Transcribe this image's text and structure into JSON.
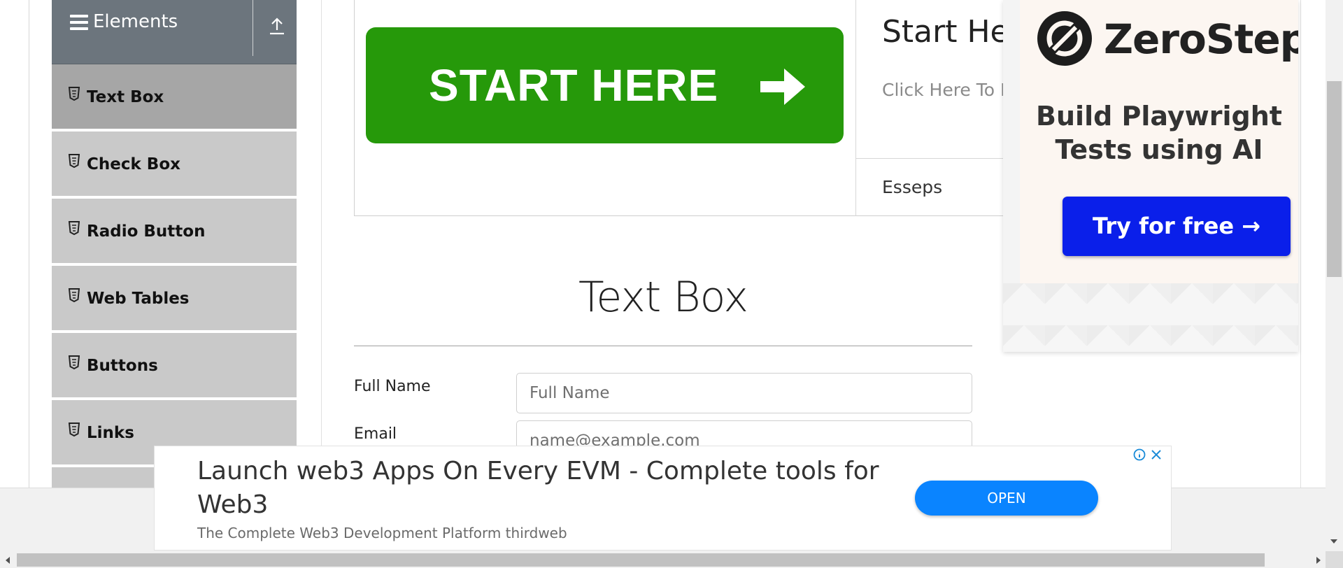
{
  "sidebar": {
    "group_title": "Elements",
    "items": [
      {
        "label": "Text Box",
        "active": true
      },
      {
        "label": "Check Box"
      },
      {
        "label": "Radio Button"
      },
      {
        "label": "Web Tables"
      },
      {
        "label": "Buttons"
      },
      {
        "label": "Links"
      }
    ]
  },
  "banner": {
    "button_text": "START HERE",
    "title": "Start Her",
    "subtitle": "Click Here To E",
    "footer": "Esseps",
    "button_color": "#26990a"
  },
  "ad_top": {
    "brand": "ZeroStep",
    "headline_line1": "Build Playwright",
    "headline_line2": "Tests using AI",
    "cta": "Try for free →",
    "cta_color": "#0a1fea"
  },
  "main": {
    "page_title": "Text Box",
    "form": {
      "full_name_label": "Full Name",
      "full_name_placeholder": "Full Name",
      "email_label": "Email",
      "email_placeholder": "name@example.com"
    }
  },
  "ad_bottom": {
    "headline": "Launch web3 Apps On Every EVM - Complete tools for Web3",
    "subline": "The Complete Web3 Development Platform thirdweb",
    "button": "OPEN",
    "button_color": "#0a84ff"
  }
}
